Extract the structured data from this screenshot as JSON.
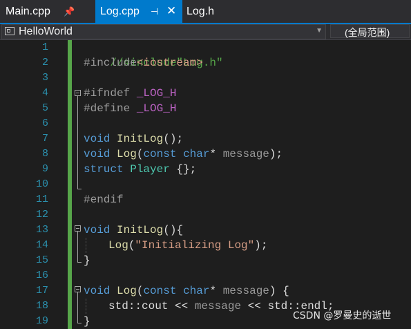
{
  "tabs": [
    {
      "label": "Main.cpp",
      "pin_icon": "pin-icon"
    },
    {
      "label": "Log.cpp",
      "pin_icon": "pin-icon",
      "close_icon": "close-icon",
      "active": true
    },
    {
      "label": "Log.h"
    }
  ],
  "navbar": {
    "scope": "HelloWorld",
    "member": "(全局范围)"
  },
  "line_numbers": [
    "1",
    "2",
    "3",
    "4",
    "5",
    "6",
    "7",
    "8",
    "9",
    "10",
    "11",
    "12",
    "13",
    "14",
    "15",
    "16",
    "17",
    "18",
    "19"
  ],
  "code": {
    "l1": "//#include\"Log.h\"",
    "l2_pre": "#include",
    "l2_hdr": "<iostream>",
    "l4_pre": "#ifndef ",
    "l4_macro": "_LOG_H",
    "l5_pre": "#define ",
    "l5_macro": "_LOG_H",
    "l7_kw": "void",
    "l7_fn": "InitLog",
    "l7_rest": "();",
    "l8_kw": "void",
    "l8_fn": "Log",
    "l8_p1": "(",
    "l8_kw2": "const",
    "l8_kw3": "char",
    "l8_star": "*",
    "l8_param": "message",
    "l8_end": ");",
    "l9_kw": "struct",
    "l9_type": "Player",
    "l9_rest": " {};",
    "l11_pre": "#endif",
    "l13_kw": "void",
    "l13_fn": "InitLog",
    "l13_rest": "(){",
    "l14_fn": "Log",
    "l14_p1": "(",
    "l14_str": "\"Initializing Log\"",
    "l14_end": ");",
    "l15": "}",
    "l17_kw": "void",
    "l17_fn": "Log",
    "l17_p1": "(",
    "l17_kw2": "const",
    "l17_kw3": "char",
    "l17_star": "*",
    "l17_param": "message",
    "l17_end": ") {",
    "l18_ns1": "std",
    "l18_sep1": "::",
    "l18_cout": "cout",
    "l18_op1": " << ",
    "l18_param": "message",
    "l18_op2": " << ",
    "l18_ns2": "std",
    "l18_sep2": "::",
    "l18_endl": "endl",
    "l18_end": ";",
    "l19": "}"
  },
  "watermark": "CSDN @罗曼史的逝世",
  "colors": {
    "accent": "#007acc",
    "line_number": "#2b91af",
    "keyword": "#569cd6",
    "comment": "#57a64a",
    "change_bar": "#57a64a"
  }
}
